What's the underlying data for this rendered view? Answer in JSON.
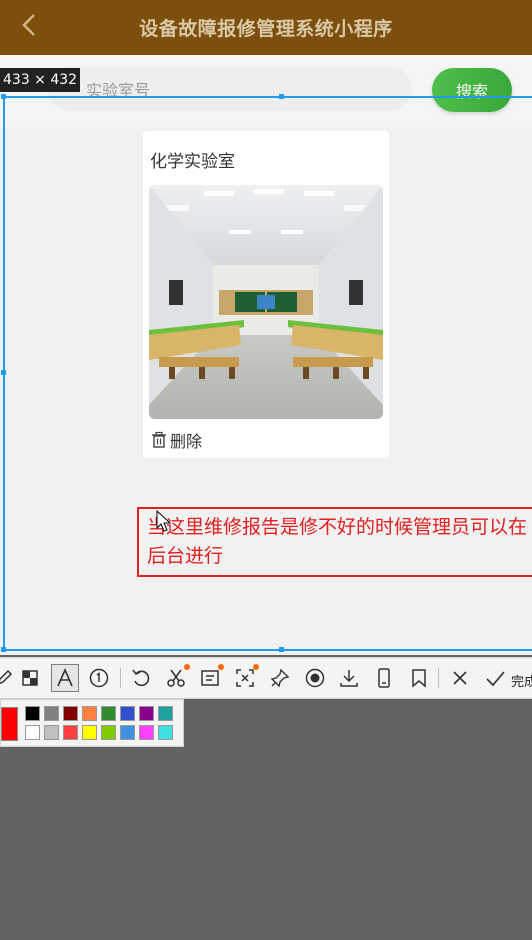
{
  "header": {
    "title": "设备故障报修管理系统小程序"
  },
  "search": {
    "placeholder": "实验室号",
    "button_label": "搜索"
  },
  "card": {
    "title": "化学实验室",
    "delete_label": "删除"
  },
  "annotation": {
    "text": "当这里维修报告是修不好的时候管理员可以在后台进行"
  },
  "selection": {
    "size_label": "433 × 432"
  },
  "toolbar": {
    "finish_label": "完成",
    "tools": [
      "pencil-icon",
      "mosaic-icon",
      "text-icon",
      "number-icon",
      "undo-icon",
      "cut-icon",
      "ocr-icon",
      "scan-icon",
      "pin-icon",
      "record-icon",
      "download-icon",
      "long-screenshot-icon",
      "bookmark-icon",
      "close-icon",
      "check-icon"
    ]
  },
  "palette": {
    "current": "#ff0000",
    "row1": [
      "#000000",
      "#808080",
      "#800000",
      "#ff8040",
      "#2e8b2e",
      "#3050d0",
      "#8b008b",
      "#20a0a0"
    ],
    "row2": [
      "#ffffff",
      "#c0c0c0",
      "#ff4040",
      "#ffff00",
      "#80cc00",
      "#4090e0",
      "#ff40ff",
      "#40e0e0"
    ]
  },
  "colors": {
    "header_bg": "#7d4f0c",
    "accent_green": "#3cae3c",
    "annotation_red": "#e02020",
    "selection_blue": "#1e9cf0"
  }
}
